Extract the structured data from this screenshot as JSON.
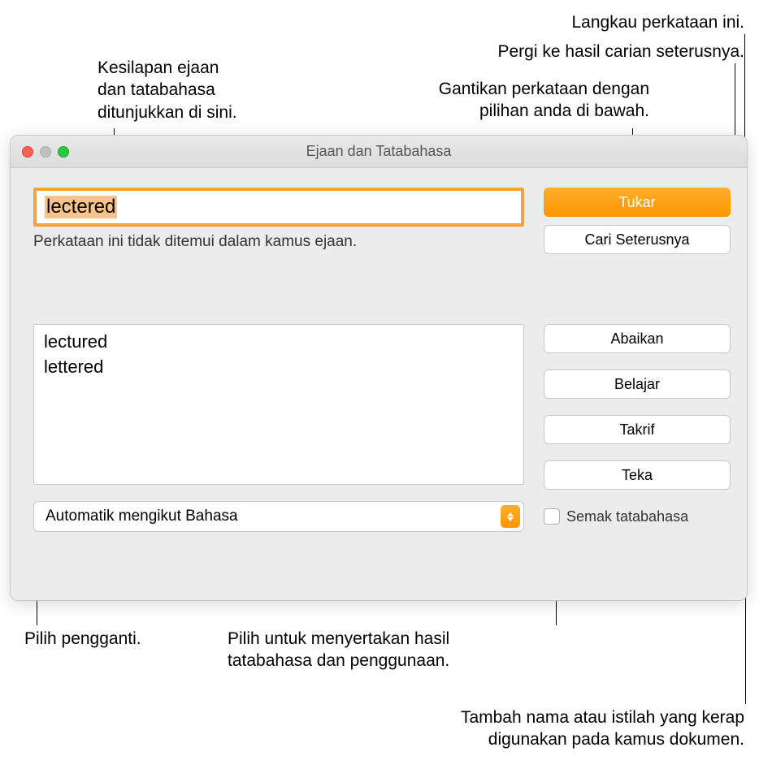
{
  "callouts": {
    "skip": "Langkau perkataan ini.",
    "next": "Pergi ke hasil carian seterusnya.",
    "errors_shown": "Kesilapan ejaan\ndan tatabahasa\nditunjukkan di sini.",
    "replace": "Gantikan perkataan dengan\npilihan anda di bawah.",
    "pick_replacement": "Pilih pengganti.",
    "grammar_check": "Pilih untuk menyertakan hasil\ntatabahasa dan penggunaan.",
    "add_term": "Tambah nama atau istilah yang kerap\ndigunakan pada kamus dokumen."
  },
  "window": {
    "title": "Ejaan dan Tatabahasa",
    "misspelled_word": "lectered",
    "status_message": "Perkataan ini tidak ditemui dalam kamus ejaan.",
    "suggestions": [
      "lectured",
      "lettered"
    ],
    "language_select": "Automatik mengikut Bahasa",
    "checkbox_label": "Semak tatabahasa",
    "buttons": {
      "change": "Tukar",
      "find_next": "Cari Seterusnya",
      "ignore": "Abaikan",
      "learn": "Belajar",
      "define": "Takrif",
      "guess": "Teka"
    }
  }
}
